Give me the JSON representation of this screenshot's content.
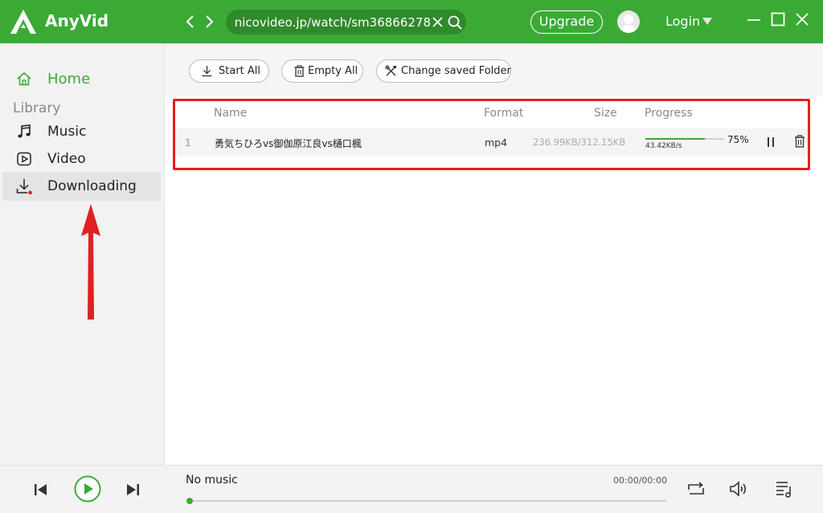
{
  "app": {
    "name": "AnyVid",
    "brand_color": "#3aaa35"
  },
  "titlebar": {
    "url": "https://www.nicovideo.jp/watch/sm36866278",
    "upgrade_label": "Upgrade",
    "login_label": "Login"
  },
  "sidebar": {
    "home_label": "Home",
    "library_label": "Library",
    "items": [
      {
        "label": "Music",
        "icon": "music-note-icon"
      },
      {
        "label": "Video",
        "icon": "video-play-icon"
      },
      {
        "label": "Downloading",
        "icon": "download-icon",
        "active": true,
        "has_dot": true
      }
    ]
  },
  "toolbar": {
    "start_all_label": "Start All",
    "empty_all_label": "Empty All",
    "change_folder_label": "Change saved Folder"
  },
  "downloads": {
    "columns": {
      "name": "Name",
      "format": "Format",
      "size": "Size",
      "progress": "Progress"
    },
    "rows": [
      {
        "index": "1",
        "name": "勇気ちひろvs御伽原江良vs樋口楓",
        "format": "mp4",
        "size": "236.99KB/312.15KB",
        "speed": "43.42KB/s",
        "percent_label": "75%",
        "progress": 0.75
      }
    ]
  },
  "player": {
    "title": "No music",
    "time": "00:00/00:00",
    "position": 0
  },
  "annotations": {
    "highlight_color": "#e02020"
  }
}
